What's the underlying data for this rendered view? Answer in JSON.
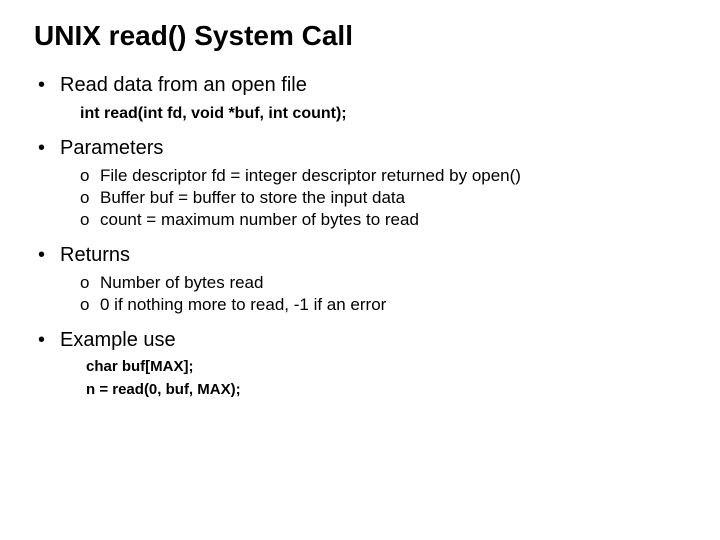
{
  "title": "UNIX read() System Call",
  "b1": {
    "text": "Read data from an open file",
    "code": "int read(int fd, void *buf, int count);"
  },
  "b2": {
    "text": "Parameters",
    "items": [
      "File descriptor fd = integer descriptor returned by open()",
      "Buffer buf = buffer to store the input data",
      "count = maximum number of bytes to read"
    ]
  },
  "b3": {
    "text": "Returns",
    "items": [
      "Number of bytes read",
      "0 if nothing more to read, -1 if an error"
    ]
  },
  "b4": {
    "text": "Example use",
    "code1": "char buf[MAX];",
    "code2": "n = read(0, buf, MAX);"
  }
}
